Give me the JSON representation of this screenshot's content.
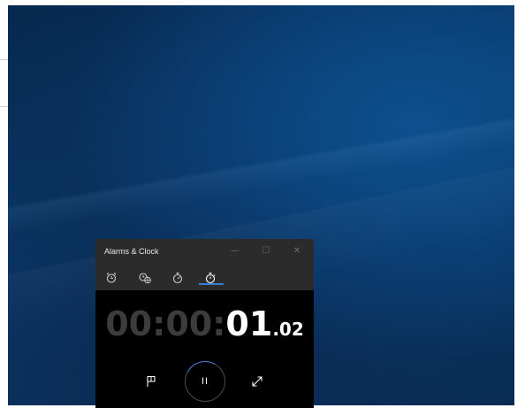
{
  "window": {
    "title": "Alarms & Clock",
    "minimize_glyph": "—",
    "maximize_glyph": "☐",
    "close_glyph": "✕"
  },
  "tabs": [
    {
      "name": "alarm",
      "icon": "alarm-clock-icon",
      "selected": false
    },
    {
      "name": "world-clock",
      "icon": "world-clock-icon",
      "selected": false
    },
    {
      "name": "timer",
      "icon": "timer-icon",
      "selected": false
    },
    {
      "name": "stopwatch",
      "icon": "stopwatch-icon",
      "selected": true
    }
  ],
  "stopwatch": {
    "hours": "00",
    "sep1": ":",
    "minutes": "00",
    "sep2": ":",
    "seconds": "01",
    "fraction": ".02"
  },
  "controls": {
    "lap_icon": "flag-icon",
    "pause_icon": "pause-icon",
    "pause_glyph": "II",
    "expand_icon": "expand-icon"
  },
  "colors": {
    "accent": "#3a7bd5",
    "titlebar": "#2b2b2b",
    "app_background": "#000000",
    "dim_digits": "#3c3c3c"
  }
}
